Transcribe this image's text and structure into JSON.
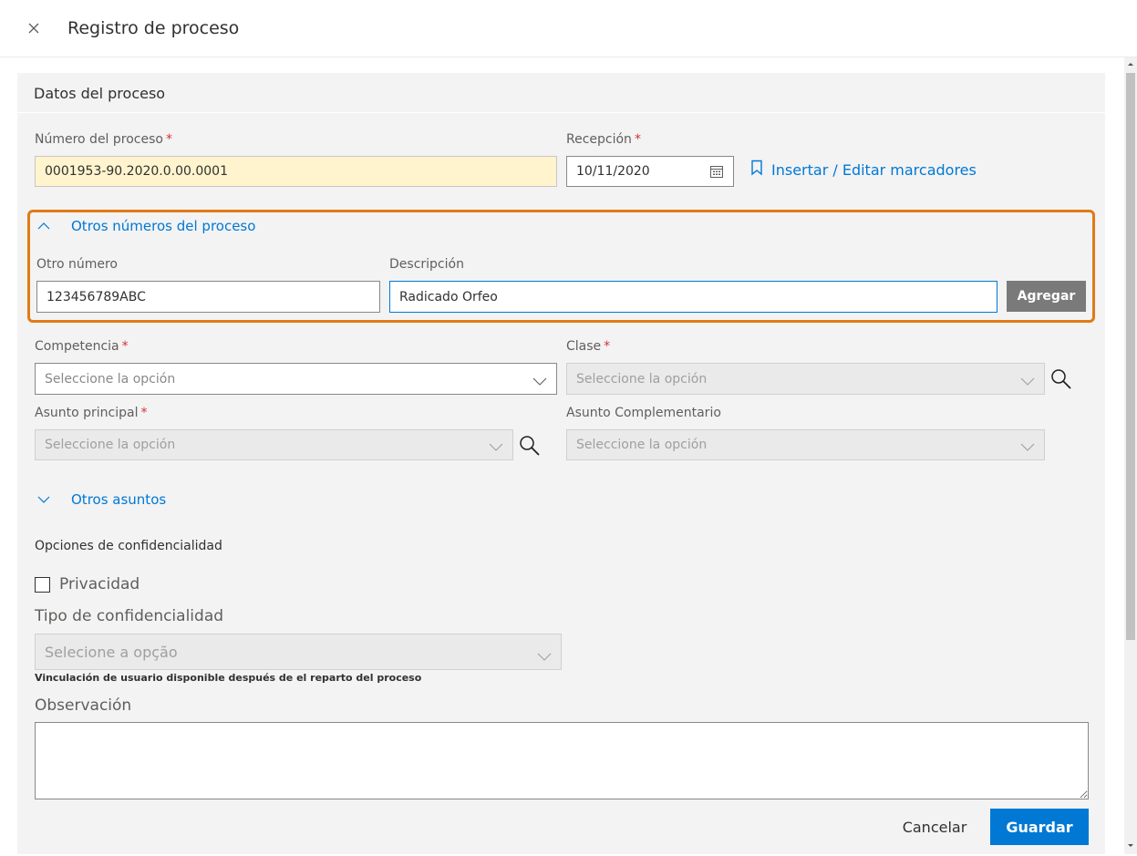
{
  "header": {
    "title": "Registro de proceso",
    "close_icon": "close-icon"
  },
  "section": {
    "title": "Datos del proceso"
  },
  "fields": {
    "numero_label": "Número del proceso",
    "numero_value": "0001953-90.2020.0.00.0001",
    "recepcion_label": "Recepción",
    "recepcion_value": "10/11/2020",
    "bookmark_link": "Insertar / Editar marcadores",
    "required_mark": "*"
  },
  "otros_numeros": {
    "title": "Otros números del proceso",
    "otro_label": "Otro número",
    "otro_value": "123456789ABC",
    "desc_label": "Descripción",
    "desc_value": "Radicado Orfeo",
    "add_button": "Agregar"
  },
  "selects": {
    "competencia_label": "Competencia",
    "competencia_placeholder": "Seleccione la opción",
    "clase_label": "Clase",
    "clase_placeholder": "Seleccione la opción",
    "asunto_label": "Asunto principal",
    "asunto_placeholder": "Seleccione la opción",
    "asunto_comp_label": "Asunto Complementario",
    "asunto_comp_placeholder": "Seleccione la opción"
  },
  "otros_asuntos": {
    "title": "Otros asuntos"
  },
  "confidencialidad": {
    "title": "Opciones de confidencialidad",
    "privacidad_label": "Privacidad",
    "privacidad_checked": false,
    "tipo_label": "Tipo de confidencialidad",
    "tipo_placeholder": "Selecione a opção",
    "note": "Vinculación de usuario disponible después de el reparto del proceso"
  },
  "observacion": {
    "label": "Observación",
    "value": ""
  },
  "footer": {
    "cancel": "Cancelar",
    "save": "Guardar"
  },
  "colors": {
    "accent": "#0078d4",
    "highlight": "#e07b16",
    "required": "#d13438",
    "yellow_field": "#fff4ce"
  }
}
